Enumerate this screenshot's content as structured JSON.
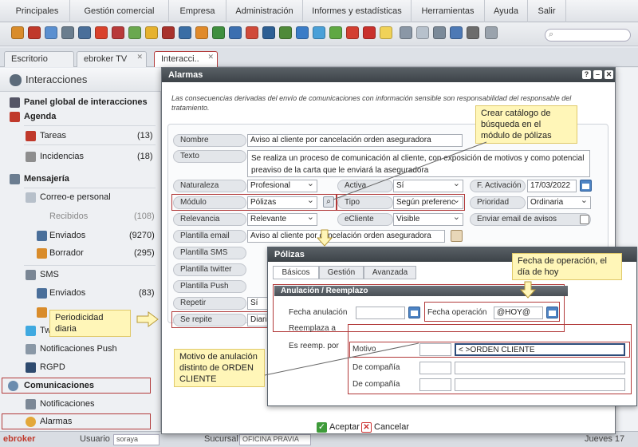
{
  "menu": [
    "Principales",
    "Gestión comercial",
    "Empresa",
    "Administración",
    "Informes y estadísticas",
    "Herramientas",
    "Ayuda",
    "Salir"
  ],
  "tabs": [
    {
      "label": "Escritorio"
    },
    {
      "label": "ebroker TV"
    },
    {
      "label": "Interacci.."
    }
  ],
  "sidebar": {
    "title": "Interacciones",
    "panel_global": "Panel global de interacciones",
    "agenda": "Agenda",
    "tareas": {
      "label": "Tareas",
      "count": "(13)"
    },
    "incidencias": {
      "label": "Incidencias",
      "count": "(18)"
    },
    "mensajeria": "Mensajería",
    "correo": "Correo-e personal",
    "recibidos": {
      "label": "Recibidos",
      "count": "(108)"
    },
    "enviados": {
      "label": "Enviados",
      "count": "(9270)"
    },
    "borrador": {
      "label": "Borrador",
      "count": "(295)"
    },
    "sms": "SMS",
    "sms_enviados": {
      "label": "Enviados",
      "count": "(83)"
    },
    "twitter": "Twitter",
    "push": "Notificaciones Push",
    "rgpd": "RGPD",
    "comunicaciones": "Comunicaciones",
    "notificaciones": "Notificaciones",
    "alarmas": "Alarmas"
  },
  "status": {
    "usuario_label": "Usuario",
    "usuario_value": "soraya",
    "sucursal_label": "Sucursal",
    "sucursal_value": "OFICINA PRAVIA",
    "date": "Jueves 17"
  },
  "dialog": {
    "title": "Alarmas",
    "disclaimer": "Las consecuencias derivadas del envío de comunicaciones con información sensible son responsabilidad del responsable del tratamiento.",
    "nombre": {
      "label": "Nombre",
      "value": "Aviso al cliente por cancelación orden aseguradora"
    },
    "texto": {
      "label": "Texto",
      "value": "Se realiza un proceso de comunicación al cliente, con exposición de motivos y como potencial preaviso de la carta que le enviará la aseguradora"
    },
    "naturaleza": {
      "label": "Naturaleza",
      "value": "Profesional"
    },
    "activa": {
      "label": "Activa",
      "value": "Sí"
    },
    "factivacion": {
      "label": "F. Activación",
      "value": "17/03/2022"
    },
    "modulo": {
      "label": "Módulo",
      "value": "Pólizas"
    },
    "tipo": {
      "label": "Tipo",
      "value": "Según preferenc"
    },
    "prioridad": {
      "label": "Prioridad",
      "value": "Ordinaria"
    },
    "relevancia": {
      "label": "Relevancia",
      "value": "Relevante"
    },
    "ecliente": {
      "label": "eCliente",
      "value": "Visible"
    },
    "enviar_email": {
      "label": "Enviar email de avisos"
    },
    "plantilla_email": {
      "label": "Plantilla email",
      "value": "Aviso al cliente por cancelación orden aseguradora"
    },
    "plantilla_sms": {
      "label": "Plantilla SMS"
    },
    "plantilla_twitter": {
      "label": "Plantilla twitter"
    },
    "plantilla_push": {
      "label": "Plantilla Push"
    },
    "repetir": {
      "label": "Repetir",
      "value": "Sí"
    },
    "se_repite": {
      "label": "Se repite",
      "value": "Diaria"
    },
    "aceptar": "Aceptar",
    "cancelar": "Cancelar"
  },
  "polizas": {
    "title": "Pólizas",
    "tabs": [
      "Básicos",
      "Gestión",
      "Avanzada"
    ],
    "section": "Anulación / Reemplazo",
    "fecha_anulacion": "Fecha anulación",
    "fecha_operacion": {
      "label": "Fecha operación",
      "value": "@HOY@"
    },
    "reemplaza": "Reemplaza a",
    "es_reemp": "Es reemp. por",
    "motivo": {
      "label": "Motivo",
      "value": "< >ORDEN CLIENTE"
    },
    "de_compania1": "De compañía",
    "de_compania2": "De compañía"
  },
  "notes": {
    "catalogo": "Crear catálogo de búsqueda en el módulo de pólizas",
    "fecha_op": "Fecha de operación, el día de hoy",
    "periodicidad": "Periodicidad diaria",
    "motivo": "Motivo de anulación distinto de ORDEN CLIENTE"
  },
  "colors": {
    "highlight": "#b23a3a",
    "note_bg": "#fff6b8",
    "header_dark": "#474d53",
    "accent_blue": "#4e84c4"
  }
}
